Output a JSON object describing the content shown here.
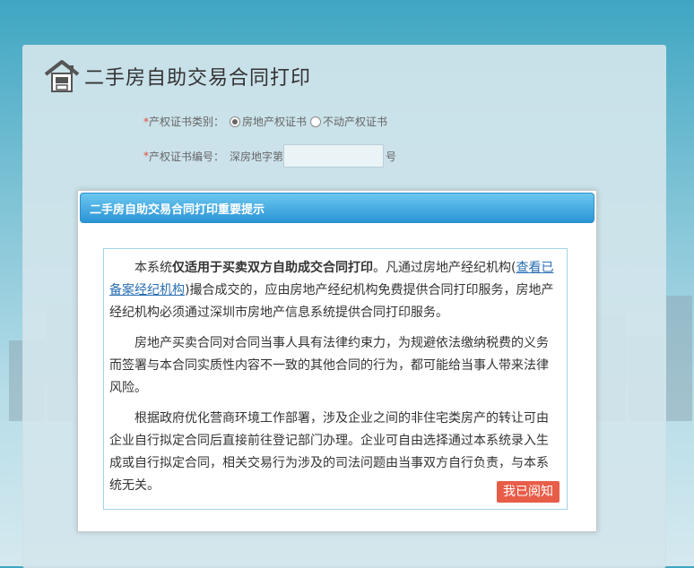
{
  "app": {
    "title": "二手房自助交易合同打印"
  },
  "form": {
    "cert_type_label": "产权证书类别：",
    "cert_type_options": [
      "房地产权证书",
      "不动产权证书"
    ],
    "cert_type_selected": "房地产权证书",
    "cert_no_label": "产权证书编号：",
    "cert_no_prefix": "深房地字第",
    "cert_no_suffix": "号",
    "cert_no_value": ""
  },
  "modal": {
    "title": "二手房自助交易合同打印重要提示",
    "p1": {
      "lead": "本系统",
      "bold": "仅适用于买卖双方自助成交合同打印",
      "mid": "。凡通过房地产经纪机构(",
      "link": "查看已备案经纪机构",
      "rest": ")撮合成交的，应由房地产经纪机构免费提供合同打印服务，房地产经纪机构必须通过深圳市房地产信息系统提供合同打印服务。"
    },
    "p2": "房地产买卖合同对合同当事人具有法律约束力，为规避依法缴纳税费的义务而签署与本合同实质性内容不一致的其他合同的行为，都可能给当事人带来法律风险。",
    "p3": "根据政府优化营商环境工作部署，涉及企业之间的非住宅类房产的转让可由企业自行拟定合同后直接前往登记部门办理。企业可自由选择通过本系统录入生成或自行拟定合同，相关交易行为涉及的司法问题由当事双方自行负责，与本系统无关。",
    "ack_label": "我已阅知"
  }
}
